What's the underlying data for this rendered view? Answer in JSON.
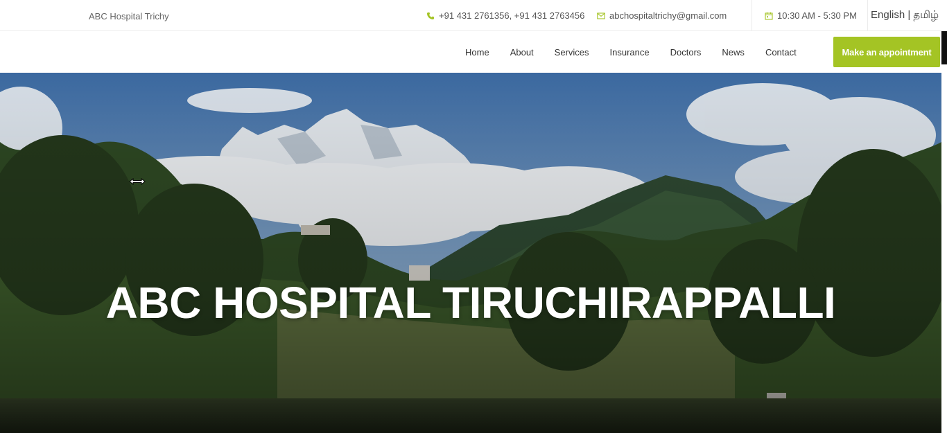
{
  "topbar": {
    "brand": "ABC Hospital Trichy",
    "phone": "+91 431 2761356, +91 431 2763456",
    "email": "abchospitaltrichy@gmail.com",
    "hours": "10:30 AM - 5:30 PM",
    "language": "English | தமிழ்"
  },
  "nav": {
    "items": [
      "Home",
      "About",
      "Services",
      "Insurance",
      "Doctors",
      "News",
      "Contact"
    ],
    "cta": "Make an appointment"
  },
  "hero": {
    "title": "ABC HOSPITAL TIRUCHIRAPPALLI"
  },
  "colors": {
    "accent": "#a4c424",
    "icon": "#a4c424"
  }
}
